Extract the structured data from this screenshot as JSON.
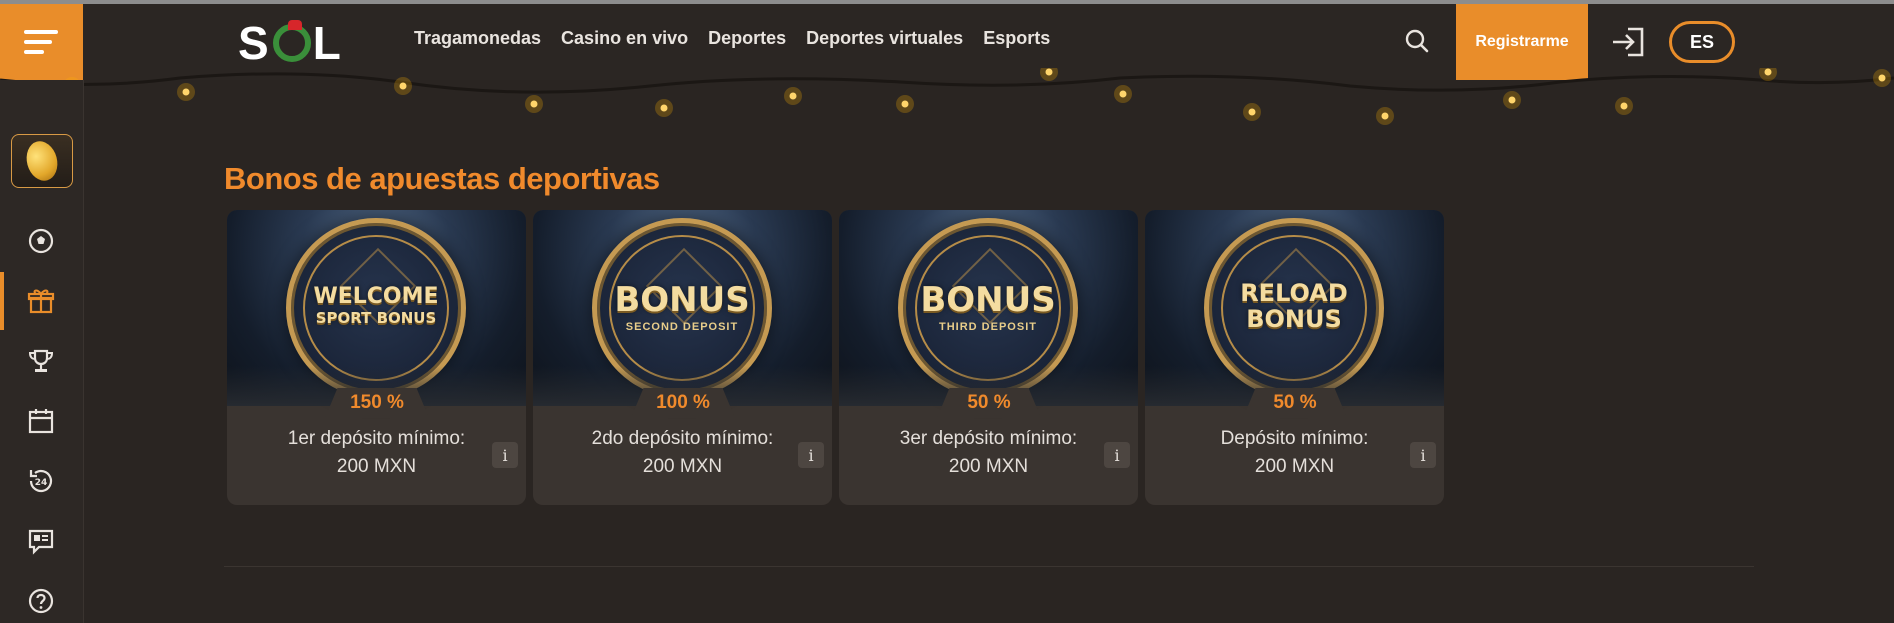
{
  "header": {
    "logo": "SOL",
    "nav": [
      "Tragamonedas",
      "Casino en vivo",
      "Deportes",
      "Deportes virtuales",
      "Esports"
    ],
    "register_label": "Registrarme",
    "language": "ES"
  },
  "sidebar": {
    "items": [
      "coin-bonus-icon",
      "football-icon",
      "gift-icon",
      "trophy-icon",
      "calendar-icon",
      "support-24-icon",
      "news-icon",
      "help-icon"
    ],
    "active_index": 2
  },
  "main": {
    "title": "Bonos de apuestas deportivas",
    "cards": [
      {
        "badge_line1": "WELCOME",
        "badge_line2": "SPORT BONUS",
        "badge_sub": "",
        "percent": "150 %",
        "desc_line1": "1er depósito mínimo:",
        "desc_line2": "200 MXN",
        "info": "i"
      },
      {
        "badge_line1": "BONUS",
        "badge_line2": "",
        "badge_sub": "SECOND DEPOSIT",
        "percent": "100 %",
        "desc_line1": "2do depósito mínimo:",
        "desc_line2": "200 MXN",
        "info": "i"
      },
      {
        "badge_line1": "BONUS",
        "badge_line2": "",
        "badge_sub": "THIRD DEPOSIT",
        "percent": "50 %",
        "desc_line1": "3er depósito mínimo:",
        "desc_line2": "200 MXN",
        "info": "i"
      },
      {
        "badge_line1": "RELOAD",
        "badge_line2": "BONUS",
        "badge_sub": "",
        "percent": "50 %",
        "desc_line1": "Depósito mínimo:",
        "desc_line2": "200 MXN",
        "info": "i"
      }
    ]
  },
  "colors": {
    "accent": "#e98d2a",
    "background": "#2a2522",
    "title": "#f08a2c"
  }
}
